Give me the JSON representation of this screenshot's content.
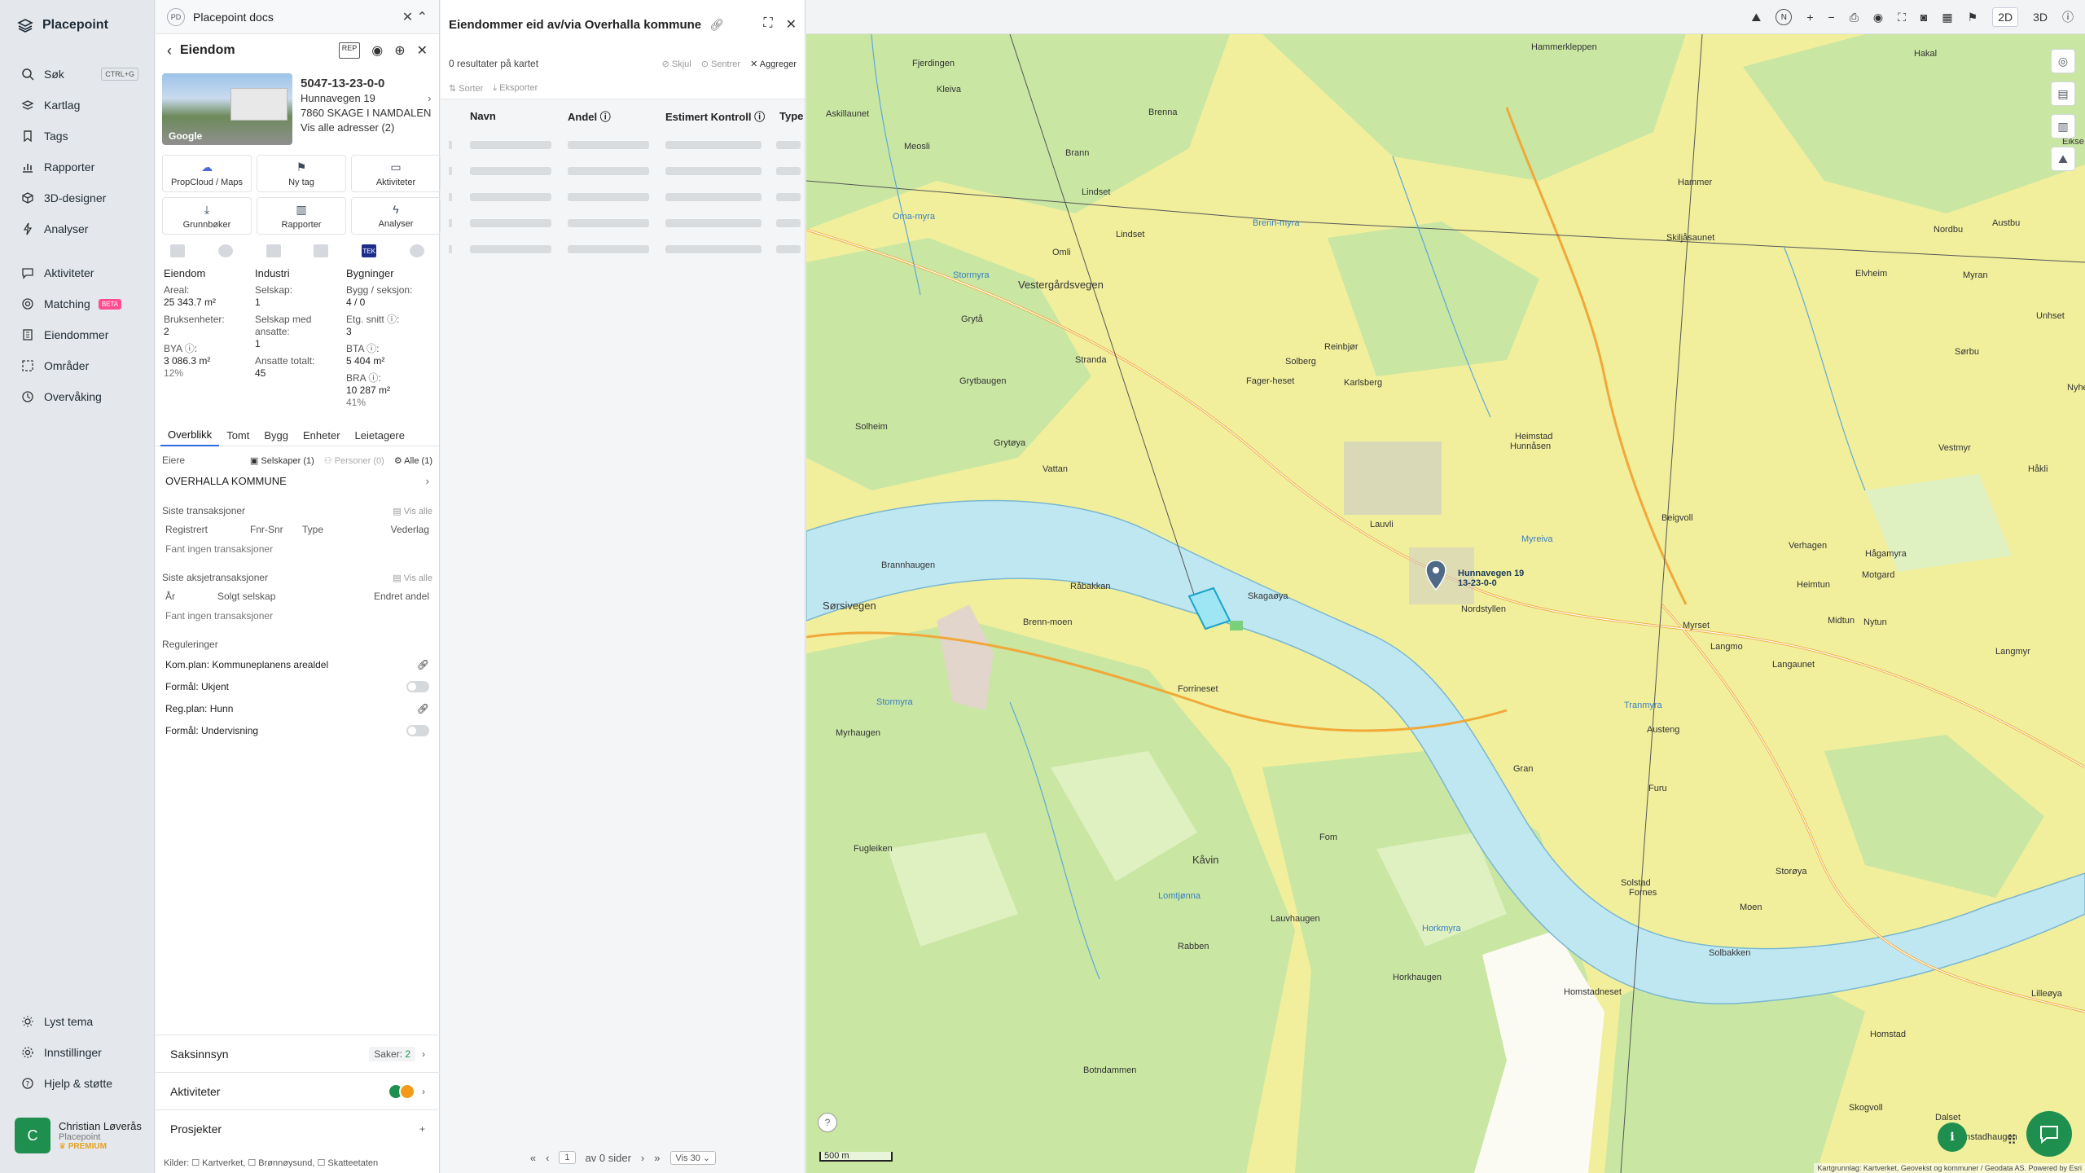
{
  "app": {
    "name": "Placepoint",
    "doc_tab": "Placepoint docs",
    "doc_tab_badge": "PD"
  },
  "nav": {
    "main": [
      {
        "label": "Søk",
        "icon": "search-icon",
        "shortcut": "CTRL+G"
      },
      {
        "label": "Kartlag",
        "icon": "layers-icon"
      },
      {
        "label": "Tags",
        "icon": "bookmark-icon"
      },
      {
        "label": "Rapporter",
        "icon": "chart-icon"
      },
      {
        "label": "3D-designer",
        "icon": "cube-icon"
      },
      {
        "label": "Analyser",
        "icon": "bolt-icon"
      }
    ],
    "secondary": [
      {
        "label": "Aktiviteter",
        "icon": "chat-icon"
      },
      {
        "label": "Matching",
        "icon": "target-icon",
        "badge": "BETA"
      },
      {
        "label": "Eiendommer",
        "icon": "building-icon"
      },
      {
        "label": "Områder",
        "icon": "area-icon"
      },
      {
        "label": "Overvåking",
        "icon": "monitor-icon"
      }
    ],
    "bottom": [
      {
        "label": "Lyst tema",
        "icon": "sun-icon"
      },
      {
        "label": "Innstillinger",
        "icon": "gear-icon"
      },
      {
        "label": "Hjelp & støtte",
        "icon": "help-icon"
      }
    ]
  },
  "user": {
    "initial": "C",
    "name": "Christian Løverås",
    "org": "Placepoint",
    "plan": "PREMIUM"
  },
  "property": {
    "header": "Eiendom",
    "id": "5047-13-23-0-0",
    "address": "Hunnavegen 19",
    "postal": "7860 SKAGE I NAMDALEN",
    "all_addresses": "Vis alle adresser (2)",
    "photo_brand": "Google",
    "actions": [
      {
        "label": "PropCloud / Maps",
        "icon": "cloud-icon"
      },
      {
        "label": "Ny tag",
        "icon": "bookmark-icon"
      },
      {
        "label": "Aktiviteter",
        "icon": "chat-icon"
      },
      {
        "label": "Grunnbøker",
        "icon": "download-icon"
      },
      {
        "label": "Rapporter",
        "icon": "chart-icon"
      },
      {
        "label": "Analyser",
        "icon": "bolt-icon"
      }
    ],
    "source_badge": "TEK",
    "stats": {
      "eiendom": {
        "header": "Eiendom",
        "areal_label": "Areal:",
        "areal": "25 343.7 m²",
        "bruks_label": "Bruksenheter:",
        "bruks": "2",
        "bya_label": "BYA ⓘ:",
        "bya": "3 086.3 m²",
        "bya_pct": "12%"
      },
      "industri": {
        "header": "Industri",
        "selskap_label": "Selskap:",
        "selskap": "1",
        "ansatte_label": "Selskap med ansatte:",
        "ansatte": "1",
        "totalt_label": "Ansatte totalt:",
        "totalt": "45"
      },
      "bygninger": {
        "header": "Bygninger",
        "bygg_label": "Bygg / seksjon:",
        "bygg": "4 / 0",
        "etg_label": "Etg. snitt ⓘ:",
        "etg": "3",
        "bta_label": "BTA ⓘ:",
        "bta": "5 404 m²",
        "bra_label": "BRA ⓘ:",
        "bra": "10 287 m²",
        "bra_pct": "41%"
      }
    },
    "tabs": [
      "Overblikk",
      "Tomt",
      "Bygg",
      "Enheter",
      "Leietagere"
    ],
    "owners": {
      "label": "Eiere",
      "companies": "Selskaper (1)",
      "persons": "Personer (0)",
      "all": "Alle (1)",
      "owner": "OVERHALLA KOMMUNE"
    },
    "transactions": {
      "label": "Siste transaksjoner",
      "show_all": "Vis alle",
      "cols": [
        "Registrert",
        "Fnr-Snr",
        "Type",
        "Vederlag"
      ],
      "empty": "Fant ingen transaksjoner"
    },
    "share_tx": {
      "label": "Siste aksjetransaksjoner",
      "show_all": "Vis alle",
      "cols": [
        "År",
        "Solgt selskap",
        "Endret andel"
      ],
      "empty": "Fant ingen transaksjoner"
    },
    "regulations": {
      "label": "Reguleringer",
      "items": [
        "Kom.plan: Kommuneplanens arealdel",
        "Formål: Ukjent",
        "Reg.plan: Hunn",
        "Formål: Undervisning"
      ]
    },
    "accordions": [
      {
        "label": "Saksinnsyn",
        "extra_label": "Saker:",
        "extra_value": "2"
      },
      {
        "label": "Aktiviteter"
      },
      {
        "label": "Prosjekter"
      }
    ],
    "sources": "Kilder: ☐ Kartverket, ☐ Brønnøysund, ☐ Skatteetaten"
  },
  "results": {
    "title": "Eiendommer eid av/via Overhalla kommune",
    "count": "0 resultater på kartet",
    "actions": [
      "Skjul",
      "Sentrer",
      "Aggreger"
    ],
    "tools": [
      "Sorter",
      "Eksporter"
    ],
    "columns": [
      "Navn",
      "Andel ⓘ",
      "Estimert Kontroll ⓘ",
      "Type"
    ],
    "pager": {
      "page": "1",
      "of": "av 0 sider",
      "per_page": "Vis 30"
    }
  },
  "map": {
    "mode_2d": "2D",
    "mode_3d": "3D",
    "scale": "500 m",
    "attribution": "Kartgrunnlag: Kartverket, Geovekst og kommuner / Geodata AS. Powered by Esri",
    "address_label": "Hunnavegen 19",
    "parcel_label": "13-23-0-0",
    "labels": [
      "Hammerkleppen",
      "Hakal",
      "Kleiva",
      "Fjerdingen",
      "Brenna",
      "Askillaunet",
      "Meosli",
      "Brann",
      "Lindset",
      "Hammer",
      "Eikse",
      "Nordbu",
      "Austbu",
      "Omli",
      "Lindset",
      "Skiljåsaunet",
      "Elvheim",
      "Myran",
      "Oma-myra",
      "Vestergårdsvegen",
      "Brenn-myra",
      "Unhset",
      "Grytå",
      "Reinbjør",
      "Sørbu",
      "Stranda",
      "Solberg",
      "Fager-heset",
      "Karlsberg",
      "Nyheim",
      "Grytbaugen",
      "Heimstad",
      "Solheim",
      "Grytøya",
      "Hunnåsen",
      "Vestmyr",
      "Håkli",
      "Vattan",
      "Lauvli",
      "Beigvoll",
      "Brannhaugen",
      "Myreiva",
      "Verhagen",
      "Hågamyra",
      "Råbakkan",
      "Skagaøya",
      "Heimtun",
      "Motgard",
      "Sørsivegen",
      "Brenn-moen",
      "Nordstyllen",
      "Myrset",
      "Midtun",
      "Nytun",
      "Langmo",
      "Langaunet",
      "Langmyr",
      "Forrineset",
      "Stormyra",
      "Tranmyra",
      "Austeng",
      "Myrhaugen",
      "Gran",
      "Furu",
      "Fugleiken",
      "Kåvin",
      "Fom",
      "Solstad",
      "Fornes",
      "Storøya",
      "Lomtjønna",
      "Lauvhaugen",
      "Moen",
      "Rabben",
      "Horkmyra",
      "Solbakken",
      "Horkhaugen",
      "Homstadneset",
      "Lilleøya",
      "Homstad",
      "Botndammen",
      "Skogvoll",
      "Dalset",
      "Homstadhaugen",
      "Stormyra"
    ]
  }
}
